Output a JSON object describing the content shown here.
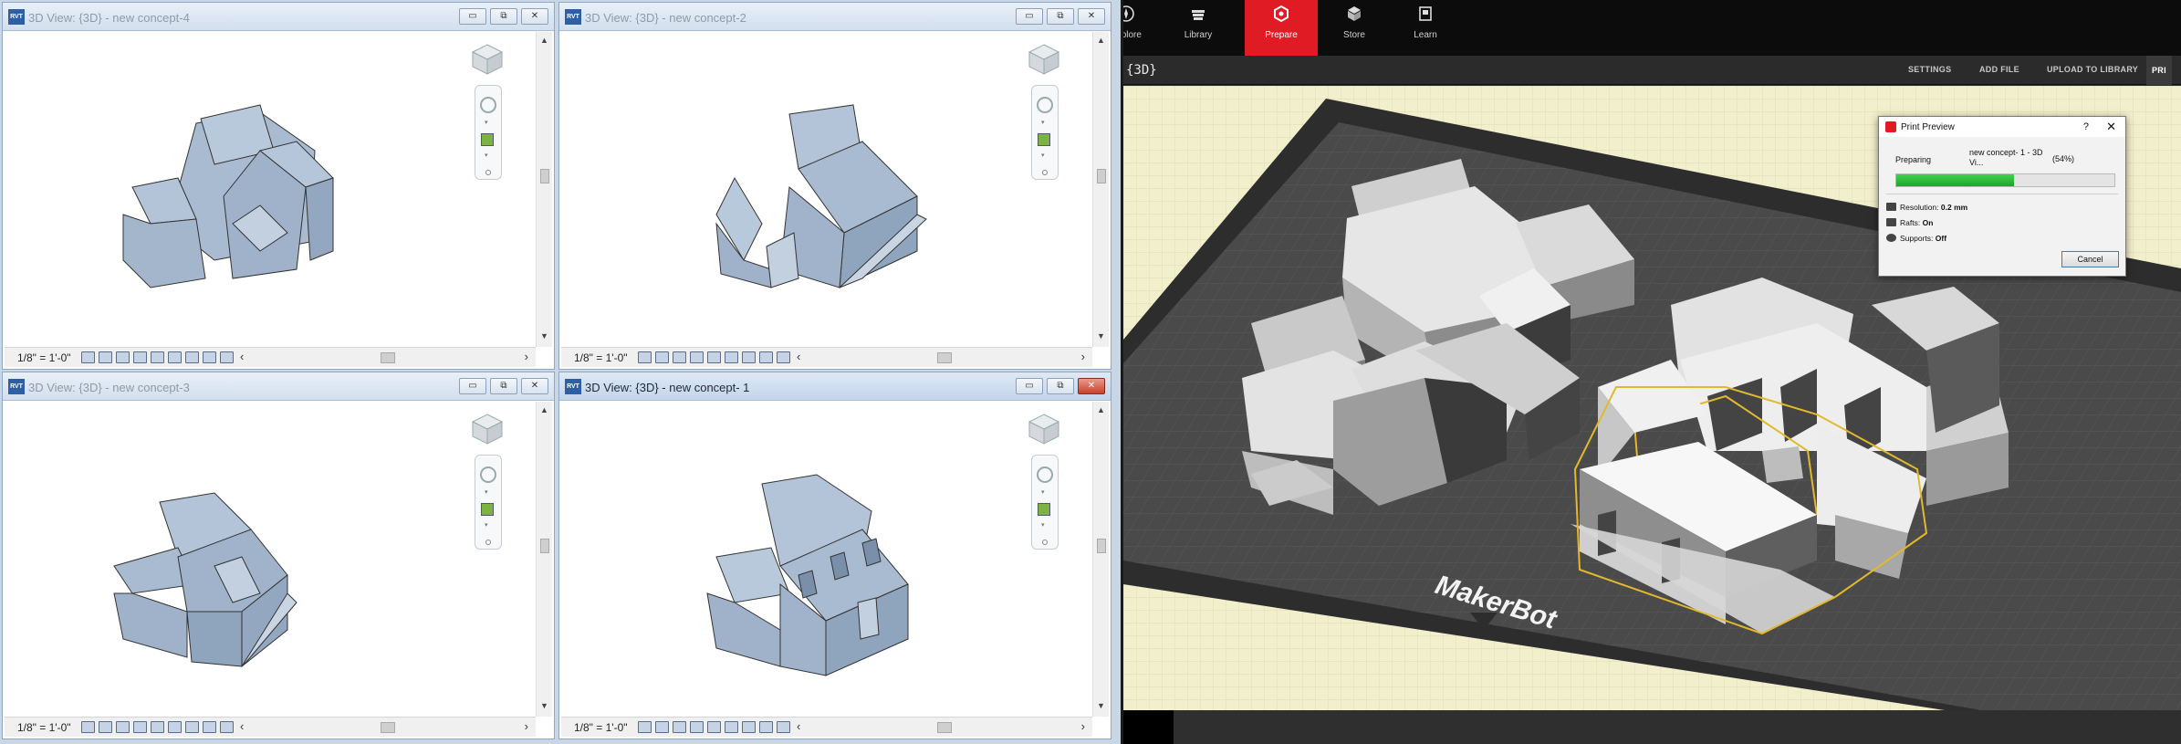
{
  "revit": {
    "panes": [
      {
        "title": "3D View: {3D} - new concept-4",
        "scale": "1/8\" = 1'-0\"",
        "active": false,
        "building": "concept-4"
      },
      {
        "title": "3D View: {3D} - new concept-2",
        "scale": "1/8\" = 1'-0\"",
        "active": false,
        "building": "concept-2"
      },
      {
        "title": "3D View: {3D} - new concept-3",
        "scale": "1/8\" = 1'-0\"",
        "active": false,
        "building": "concept-3"
      },
      {
        "title": "3D View: {3D} - new concept- 1",
        "scale": "1/8\" = 1'-0\"",
        "active": true,
        "building": "concept-1"
      }
    ],
    "window_buttons": {
      "minimize": "▭",
      "restore": "⧉",
      "close": "✕"
    },
    "scroll": {
      "left": "‹",
      "right": "›",
      "up": "▲",
      "down": "▼"
    },
    "model_color": "#a9bbd0"
  },
  "makerbot": {
    "nav": [
      {
        "label": "Explore",
        "icon": "compass-icon",
        "active": false
      },
      {
        "label": "Library",
        "icon": "library-icon",
        "active": false
      },
      {
        "label": "Prepare",
        "icon": "prepare-icon",
        "active": true
      },
      {
        "label": "Store",
        "icon": "store-icon",
        "active": false
      },
      {
        "label": "Learn",
        "icon": "learn-icon",
        "active": false
      }
    ],
    "view_label": "{3D}",
    "toolbar": {
      "settings": "SETTINGS",
      "add_file": "ADD FILE",
      "upload": "UPLOAD TO LIBRARY",
      "print": "PRI"
    },
    "platform_logo": "MakerBot",
    "accent_color": "#e01b24",
    "selection_color": "#e2b92c"
  },
  "print_preview": {
    "title": "Print Preview",
    "help": "?",
    "close": "✕",
    "status_label": "Preparing",
    "file_name": "new concept- 1 - 3D Vi...",
    "percent_text": "(54%)",
    "progress": 0.54,
    "resolution_label": "Resolution:",
    "resolution_value": "0.2 mm",
    "rafts_label": "Rafts:",
    "rafts_value": "On",
    "supports_label": "Supports:",
    "supports_value": "Off",
    "cancel_label": "Cancel"
  }
}
